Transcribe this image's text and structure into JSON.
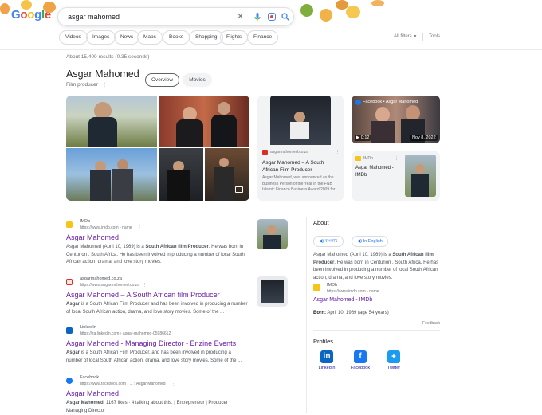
{
  "search": {
    "query": "asgar mahomed"
  },
  "logo": {
    "parts": [
      "G",
      "o",
      "o",
      "g",
      "l",
      "e"
    ]
  },
  "tabs": [
    "Videos",
    "Images",
    "News",
    "Maps",
    "Books",
    "Shopping",
    "Flights",
    "Finance"
  ],
  "all_filters": "All filters",
  "tools": "Tools",
  "stats": "About 15,400 results (0.35 seconds)",
  "kp": {
    "title": "Asgar Mahomed",
    "subtitle": "Film producer",
    "tabs": [
      "Overview",
      "Movies"
    ]
  },
  "image_cards": {
    "site_card": {
      "source": "asgarmahomed.co.za",
      "title": "Asgar Mahomed – A South African Film Producer",
      "snippet": "Asgar Mahomed, was announced as the Business Person of the Year in the FNB Islamic Finance Business Award 2009 for..."
    },
    "video_card": {
      "source": "Facebook • Asgar Mahomed",
      "duration": "0:12",
      "date": "Nov 8, 2022"
    },
    "imdb_card": {
      "source": "IMDb",
      "title": "Asgar Mahomed - IMDb"
    }
  },
  "results": [
    {
      "site": "IMDb",
      "url": "https://www.imdb.com › name",
      "title": "Asgar Mahomed",
      "snippet_html": [
        "Asgar Mahomed (April 10, 1969) is a ",
        "South African film Producer",
        ". He was born in Centurion , South Africa. He has been involved in producing a number of local South African action, drama, and love story movies."
      ]
    },
    {
      "site": "asgarmahomed.co.za",
      "url": "https://www.asgarmahomed.co.za",
      "title": "Asgar Mahomed – A South African film Producer",
      "snippet_html": [
        "",
        "Asgar",
        " is a South African Film Producer and has been involved in producing a number of local South African action, drama, and love story movies. Some of the ..."
      ]
    },
    {
      "site": "LinkedIn",
      "url": "https://za.linkedin.com › asgar-mahomed-05986612",
      "title": "Asgar Mahomed - Managing Director - Enzine Events",
      "snippet_html": [
        "",
        "Asgar",
        " is a South African Film Producer, and has been involved in producing a number of local South African action, drama, and love story movies. Some of the ..."
      ]
    },
    {
      "site": "Facebook",
      "url": "https://www.facebook.com › ... › Asgar Mahomed",
      "title": "Asgar Mahomed",
      "snippet_html": [
        "",
        "Asgar Mahomed",
        ". 1167 likes · 4 talking about this. | Entrepreneur | Producer | Managing Director"
      ]
    }
  ],
  "about": {
    "heading": "About",
    "langs": [
      "বাংলায়",
      "In English"
    ],
    "text_parts": [
      "Asgar Mahomed (April 10, 1969) is a ",
      "South African film Producer",
      ". He was born in Centurion , South Africa. He has been involved in producing a number of local South African action, drama, and love story movies."
    ],
    "source_name": "IMDb",
    "source_url": "https://www.imdb.com › name",
    "source_link": "Asgar Mahomed - IMDb",
    "born_label": "Born:",
    "born_value": " April 10, 1969 (age 54 years)",
    "feedback": "Feedback",
    "profiles_heading": "Profiles",
    "profiles": [
      "LinkedIn",
      "Facebook",
      "Twitter"
    ]
  },
  "colors": {
    "link": "#681da8",
    "blue": "#1a73e8",
    "linkedin": "#0a66c2",
    "facebook": "#1877f2",
    "twitter": "#1d9bf0"
  }
}
